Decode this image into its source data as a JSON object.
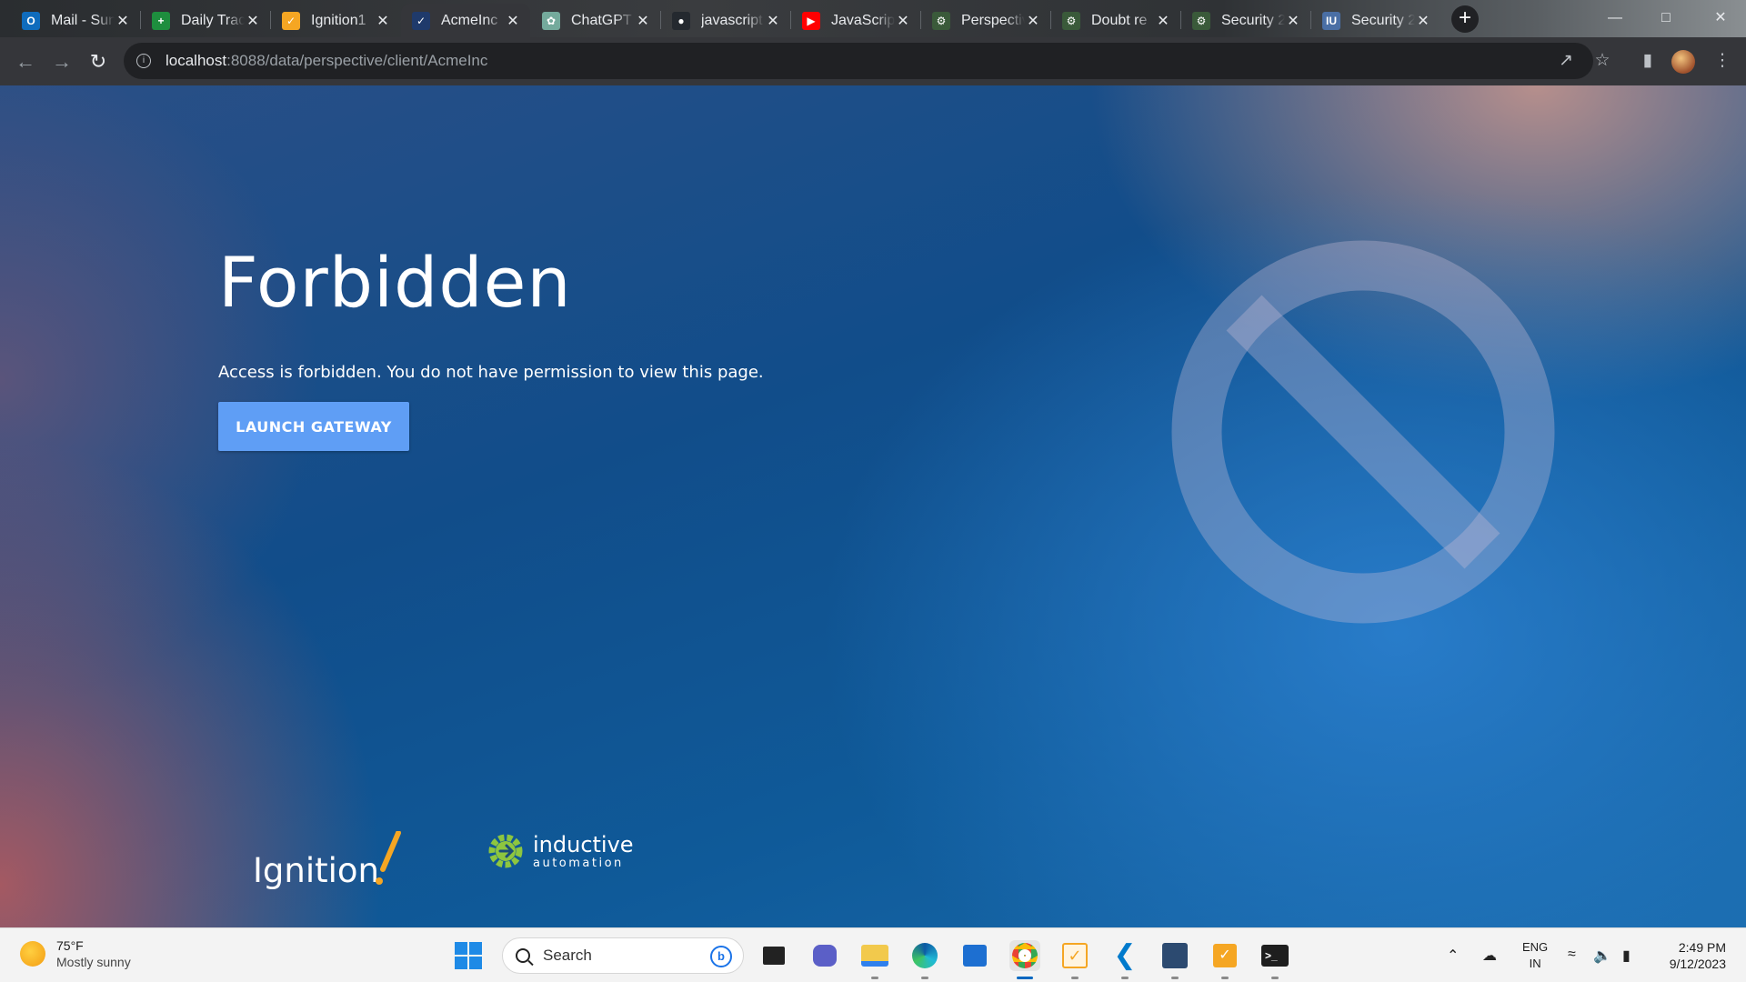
{
  "browser": {
    "tabs": [
      {
        "title": "Mail - Sun",
        "icon": "outlook-icon",
        "color": "#0f6cbd",
        "glyph": "O"
      },
      {
        "title": "Daily Tracker",
        "icon": "sheets-icon",
        "color": "#1e8e3e",
        "glyph": "+"
      },
      {
        "title": "Ignition1",
        "icon": "ignition-icon",
        "color": "#f5a623",
        "glyph": "✓"
      },
      {
        "title": "AcmeInc",
        "icon": "perspective-icon",
        "color": "#1f3a6b",
        "glyph": "✓"
      },
      {
        "title": "ChatGPT",
        "icon": "chatgpt-icon",
        "color": "#74aa9c",
        "glyph": "✿"
      },
      {
        "title": "javascript",
        "icon": "github-icon",
        "color": "#24292f",
        "glyph": "●"
      },
      {
        "title": "JavaScript",
        "icon": "youtube-icon",
        "color": "#ff0000",
        "glyph": "▶"
      },
      {
        "title": "Perspective",
        "icon": "inductive-gear-icon",
        "color": "#3a5a3a",
        "glyph": "⚙"
      },
      {
        "title": "Doubt re",
        "icon": "inductive-gear-icon",
        "color": "#3a5a3a",
        "glyph": "⚙"
      },
      {
        "title": "Security 2",
        "icon": "inductive-gear-icon",
        "color": "#3a5a3a",
        "glyph": "⚙"
      },
      {
        "title": "Security 2",
        "icon": "iu-icon",
        "color": "#4a6fa5",
        "glyph": "IU"
      }
    ],
    "active_tab": 3,
    "url_host": "localhost",
    "url_path": ":8088/data/perspective/client/AcmeInc"
  },
  "page": {
    "title": "Forbidden",
    "message": "Access is forbidden. You do not have permission to view this page.",
    "button_label": "LAUNCH GATEWAY",
    "brand_ignition": "Ignition",
    "brand_inductive_1": "inductive",
    "brand_inductive_2": "automation"
  },
  "taskbar": {
    "weather_temp": "75°F",
    "weather_cond": "Mostly sunny",
    "search_placeholder": "Search",
    "lang_1": "ENG",
    "lang_2": "IN",
    "time": "2:49 PM",
    "date": "9/12/2023"
  }
}
